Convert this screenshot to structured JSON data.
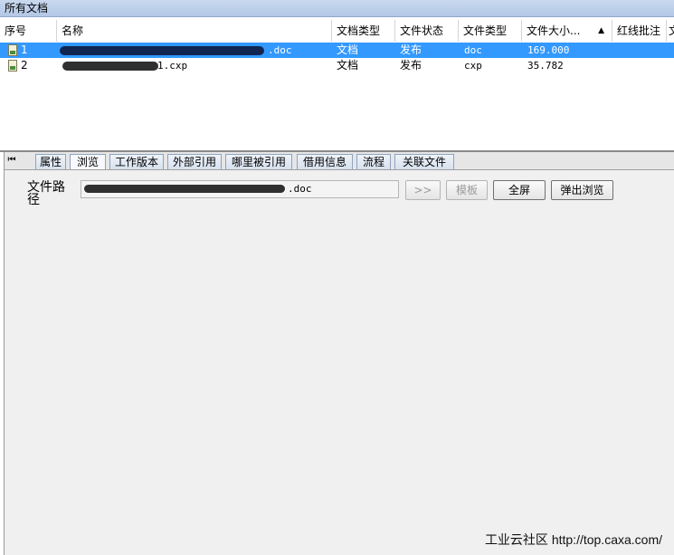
{
  "panel_title": "所有文档",
  "table": {
    "columns": [
      "序号",
      "名称",
      "文档类型",
      "文件状态",
      "文件类型",
      "文件大小...",
      "红线批注",
      "文"
    ],
    "sort_icon": "sort-ascending-icon",
    "rows": [
      {
        "index": "1",
        "name_suffix": ".doc",
        "doc_type": "文档",
        "status": "发布",
        "file_type": "doc",
        "size": "169.000",
        "selected": true
      },
      {
        "index": "2",
        "name_suffix": "1.cxp",
        "doc_type": "文档",
        "status": "发布",
        "file_type": "cxp",
        "size": "35.782",
        "selected": false
      }
    ]
  },
  "tabs": [
    {
      "label": "属性"
    },
    {
      "label": "浏览",
      "active": true
    },
    {
      "label": "工作版本"
    },
    {
      "label": "外部引用"
    },
    {
      "label": "哪里被引用"
    },
    {
      "label": "借用信息"
    },
    {
      "label": "流程"
    },
    {
      "label": "关联文件"
    }
  ],
  "browse": {
    "path_label": "文件路径",
    "path_value_suffix": ".doc",
    "buttons": {
      "next": ">>",
      "template": "模板",
      "fullscreen": "全屏",
      "popup": "弹出浏览"
    }
  },
  "watermark": "工业云社区 http://top.caxa.com/",
  "colors": {
    "selection": "#3399ff",
    "title_bar": "#c9d9ef"
  }
}
